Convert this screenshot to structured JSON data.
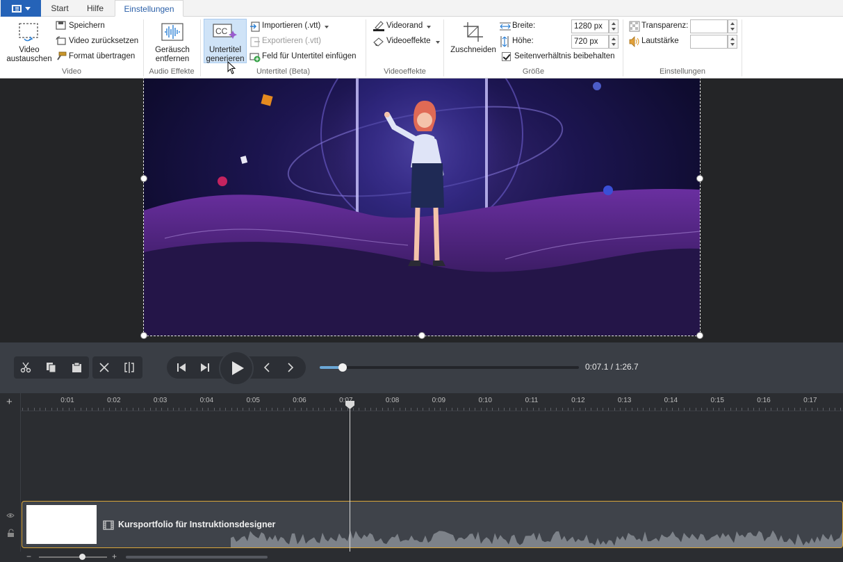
{
  "tabs": [
    {
      "label": "Start"
    },
    {
      "label": "Hilfe"
    },
    {
      "label": "Einstellungen",
      "active": true
    }
  ],
  "ribbon": {
    "video_group": {
      "label": "Video",
      "replace_line1": "Video",
      "replace_line2": "austauschen",
      "save": "Speichern",
      "reset": "Video zurücksetzen",
      "format": "Format übertragen"
    },
    "audio_group": {
      "label": "Audio Effekte",
      "noise_line1": "Geräusch",
      "noise_line2": "entfernen"
    },
    "subtitle_group": {
      "label": "Untertitel (Beta)",
      "generate_line1": "Untertitel",
      "generate_line2": "generieren",
      "import": "Importieren (.vtt)",
      "export": "Exportieren (.vtt)",
      "insert_field": "Feld für Untertitel einfügen"
    },
    "effects_group": {
      "label": "Videoeffekte",
      "border": "Videorand",
      "effects": "Videoeffekte"
    },
    "size_group": {
      "label": "Größe",
      "crop": "Zuschneiden",
      "width_label": "Breite:",
      "width_value": "1280 px",
      "height_label": "Höhe:",
      "height_value": "720 px",
      "keep_ratio": "Seitenverhältnis beibehalten",
      "keep_ratio_checked": true
    },
    "settings_group": {
      "label": "Einstellungen",
      "transparency_label": "Transparenz:",
      "transparency_value": "",
      "volume_label": "Lautstärke",
      "volume_value": ""
    }
  },
  "player": {
    "timecode": "0:07.1 / 1:26.7",
    "progress": 0.088
  },
  "timeline": {
    "add_track": "+",
    "ruler": [
      "0:01",
      "0:02",
      "0:03",
      "0:04",
      "0:05",
      "0:06",
      "0:07",
      "0:08",
      "0:09",
      "0:10",
      "0:11",
      "0:12",
      "0:13",
      "0:14",
      "0:15",
      "0:16",
      "0:17"
    ],
    "clip_title": "Kursportfolio für Instruktionsdesigner",
    "zoom_minus": "−",
    "zoom_plus": "+"
  },
  "colors": {
    "accent": "#2563b8",
    "clip_border": "#d9a63a",
    "progress": "#6aa7d6"
  }
}
